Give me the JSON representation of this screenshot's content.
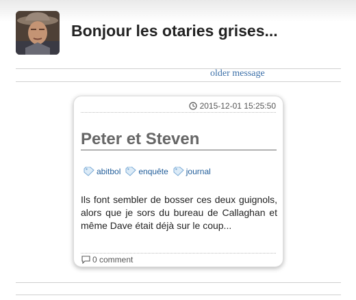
{
  "header": {
    "avatar_icon": "cowboy-portrait-avatar",
    "title": "Bonjour les otaries grises..."
  },
  "nav": {
    "older_label": "older message"
  },
  "post": {
    "date": "2015-12-01 15:25:50",
    "date_icon": "clock-icon",
    "title": "Peter et Steven",
    "tags": [
      {
        "label": "abitbol",
        "icon": "tag-icon"
      },
      {
        "label": "enquête",
        "icon": "tag-icon"
      },
      {
        "label": "journal",
        "icon": "tag-icon"
      }
    ],
    "excerpt": "Ils font sembler de bosser ces deux guignols, alors que je sors du bureau de Callaghan et même Dave était déjà sur le coup...",
    "comments_label": "0 comment",
    "comments_icon": "speech-bubble-icon"
  },
  "colors": {
    "link": "#3b6fa8",
    "tag_link": "#1f5c99",
    "title_text": "#222222",
    "post_title": "#666666"
  }
}
